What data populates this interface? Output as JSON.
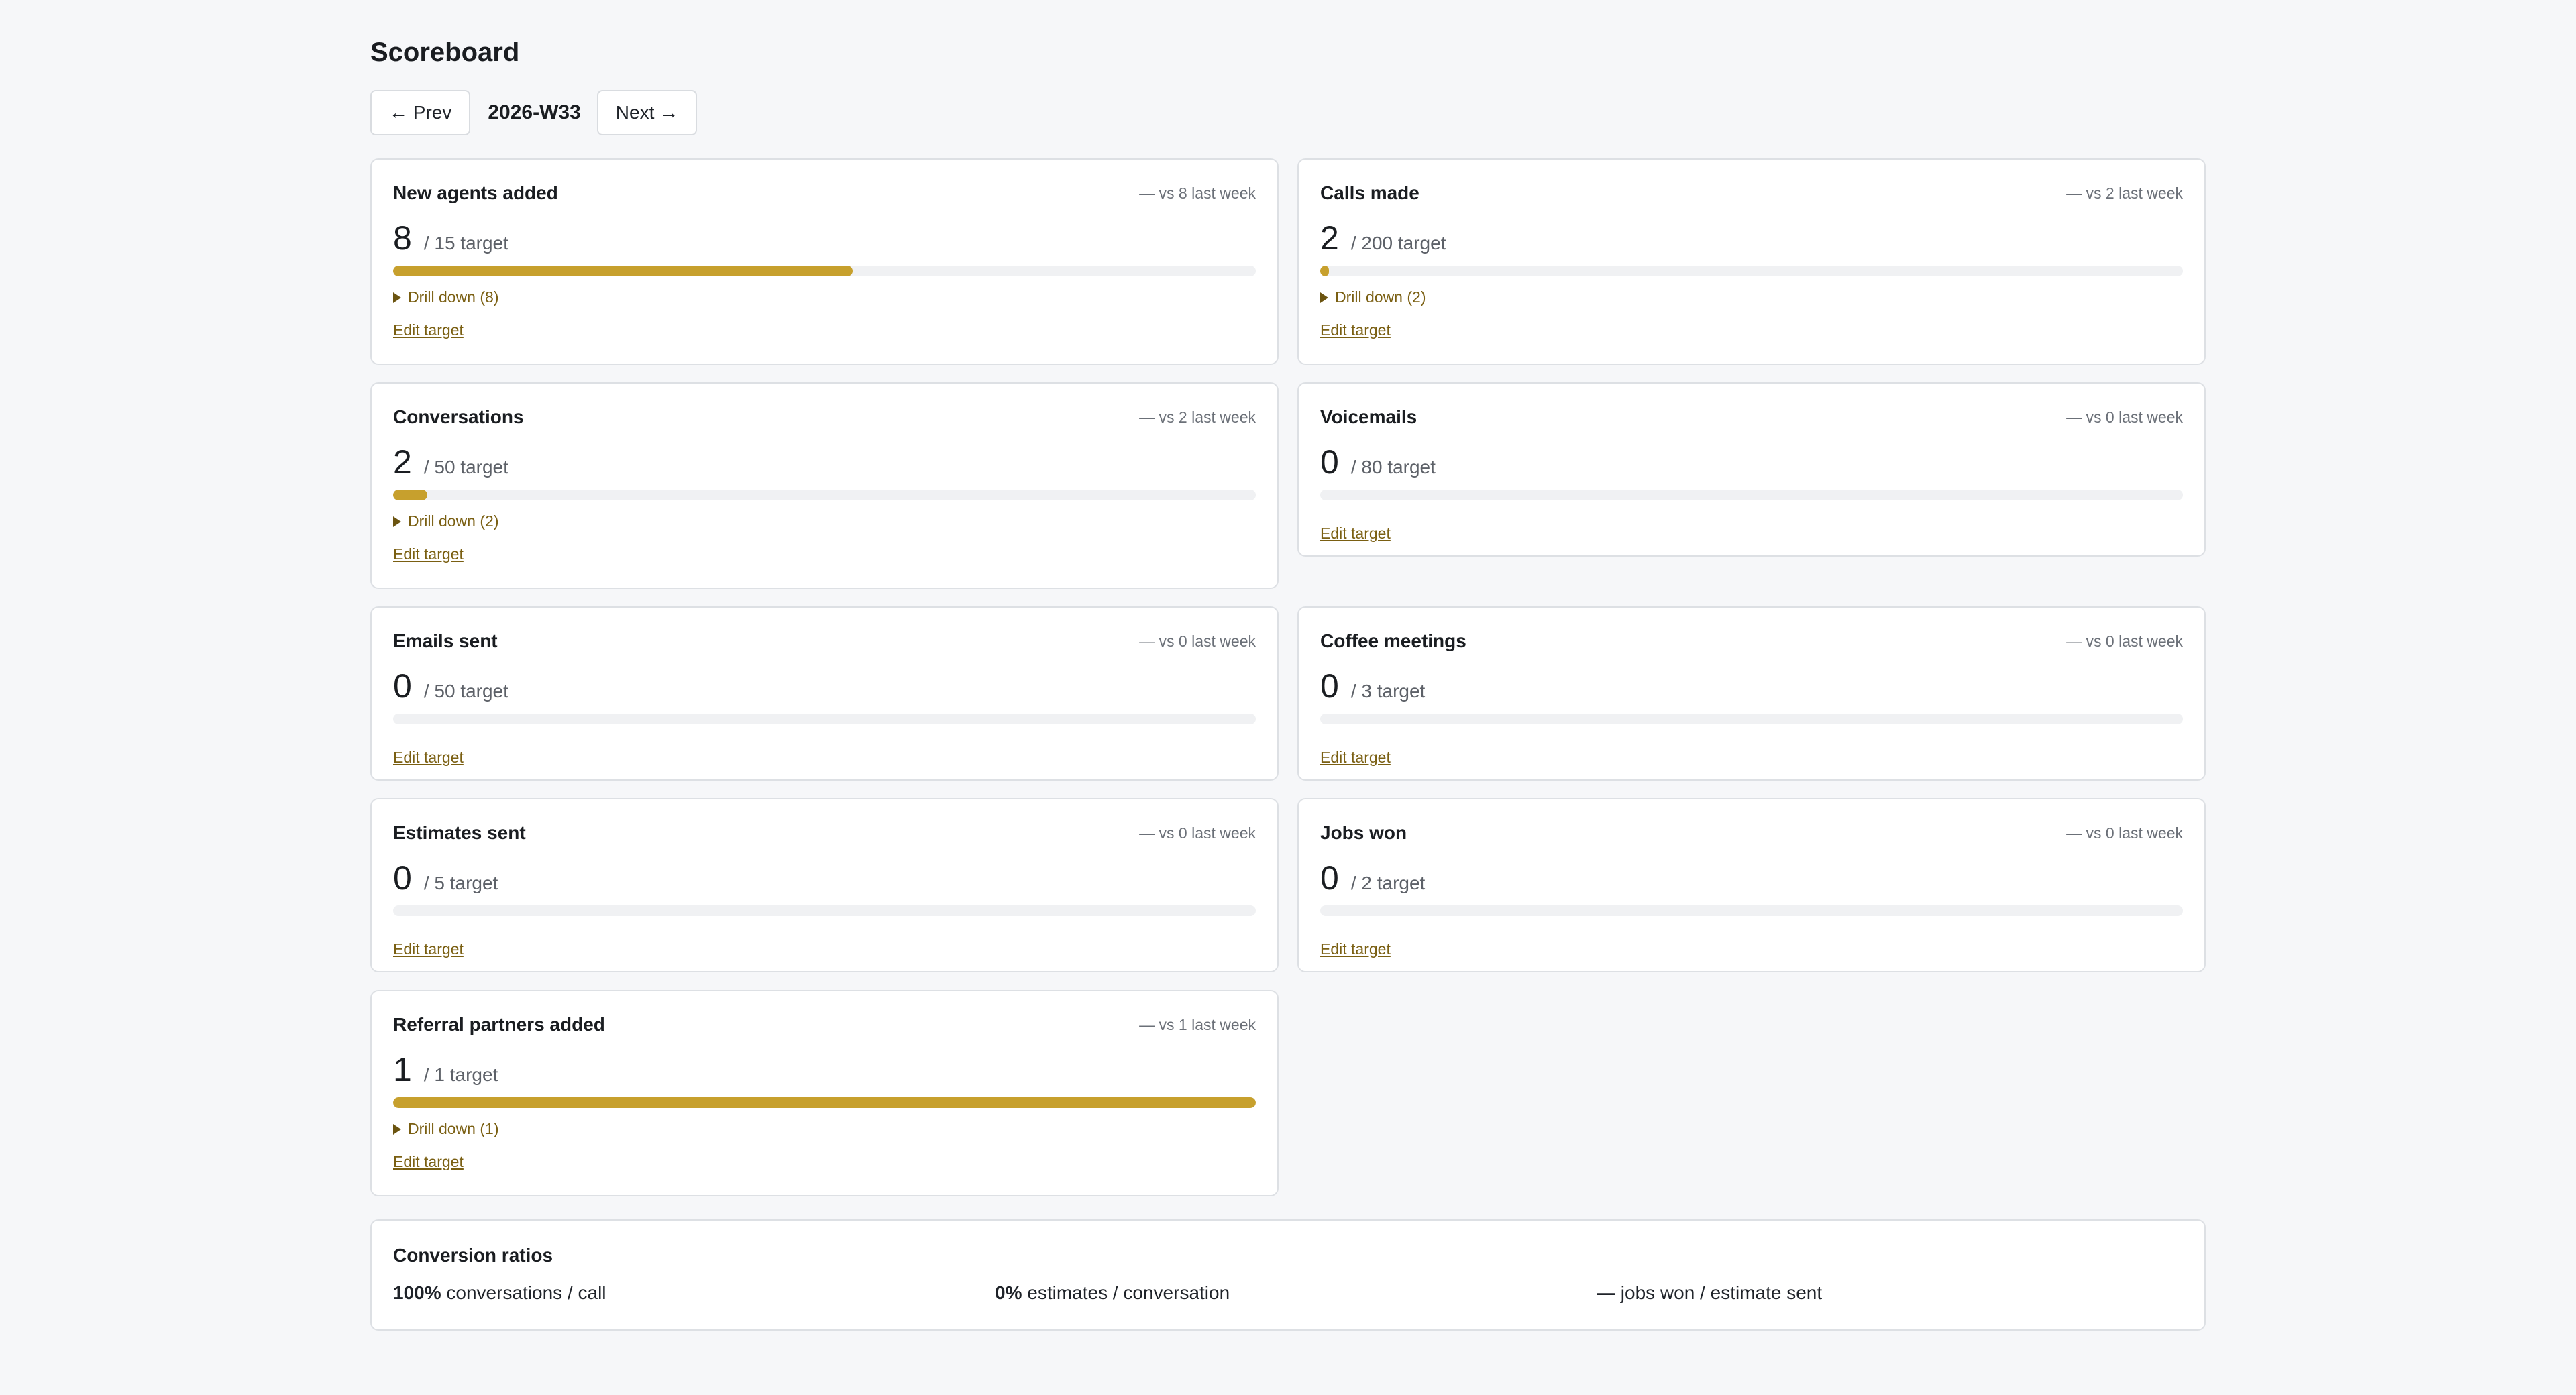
{
  "page": {
    "title": "Scoreboard"
  },
  "weeknav": {
    "prev_label": "← Prev",
    "week": "2026-W33",
    "next_label": "Next →"
  },
  "colors": {
    "accent": "#c7a02d",
    "link": "#7a5f12",
    "track": "#f0f1f3"
  },
  "metrics": [
    {
      "title": "New agents added",
      "delta": "— vs 8 last week",
      "value": "8",
      "target": "/ 15 target",
      "progress": 0.533,
      "drill": "Drill down (8)",
      "edit": "Edit target"
    },
    {
      "title": "Calls made",
      "delta": "— vs 2 last week",
      "value": "2",
      "target": "/ 200 target",
      "progress": 0.01,
      "drill": "Drill down (2)",
      "edit": "Edit target"
    },
    {
      "title": "Conversations",
      "delta": "— vs 2 last week",
      "value": "2",
      "target": "/ 50 target",
      "progress": 0.04,
      "drill": "Drill down (2)",
      "edit": "Edit target"
    },
    {
      "title": "Voicemails",
      "delta": "— vs 0 last week",
      "value": "0",
      "target": "/ 80 target",
      "progress": 0,
      "drill": null,
      "edit": "Edit target"
    },
    {
      "title": "Emails sent",
      "delta": "— vs 0 last week",
      "value": "0",
      "target": "/ 50 target",
      "progress": 0,
      "drill": null,
      "edit": "Edit target"
    },
    {
      "title": "Coffee meetings",
      "delta": "— vs 0 last week",
      "value": "0",
      "target": "/ 3 target",
      "progress": 0,
      "drill": null,
      "edit": "Edit target"
    },
    {
      "title": "Estimates sent",
      "delta": "— vs 0 last week",
      "value": "0",
      "target": "/ 5 target",
      "progress": 0,
      "drill": null,
      "edit": "Edit target"
    },
    {
      "title": "Jobs won",
      "delta": "— vs 0 last week",
      "value": "0",
      "target": "/ 2 target",
      "progress": 0,
      "drill": null,
      "edit": "Edit target"
    },
    {
      "title": "Referral partners added",
      "delta": "— vs 1 last week",
      "value": "1",
      "target": "/ 1 target",
      "progress": 1.0,
      "drill": "Drill down (1)",
      "edit": "Edit target"
    }
  ],
  "ratios": {
    "title": "Conversion ratios",
    "items": [
      {
        "value": "100%",
        "label": "conversations / call"
      },
      {
        "value": "0%",
        "label": "estimates / conversation"
      },
      {
        "value": "—",
        "label": "jobs won / estimate sent"
      }
    ]
  }
}
